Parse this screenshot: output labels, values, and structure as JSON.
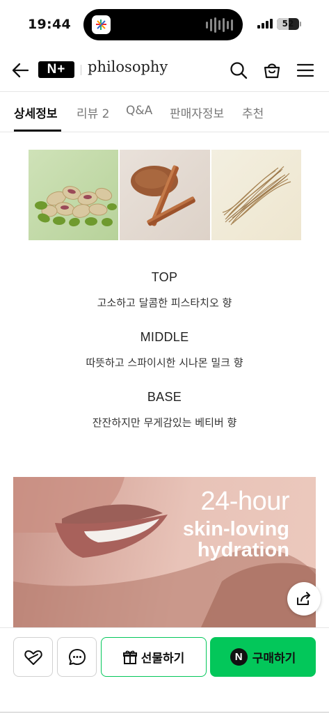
{
  "status_bar": {
    "time": "19:44",
    "battery": "52",
    "battery_level": 0.52
  },
  "header": {
    "logo_text": "N+",
    "brand_name": "philosophy",
    "icons": [
      "back-arrow-icon",
      "search-icon",
      "shopping-bag-icon",
      "hamburger-menu-icon"
    ]
  },
  "tabs": [
    {
      "label": "상세정보",
      "active": true
    },
    {
      "label": "리뷰 2",
      "active": false
    },
    {
      "label": "Q&A",
      "active": false
    },
    {
      "label": "판매자정보",
      "active": false
    },
    {
      "label": "추천",
      "active": false
    }
  ],
  "ingredients": [
    "pistachio",
    "cinnamon",
    "vetiver-root"
  ],
  "notes": [
    {
      "title": "TOP",
      "desc": "고소하고 달콤한 피스타치오 향"
    },
    {
      "title": "MIDDLE",
      "desc": "따뜻하고 스파이시한 시나몬 밀크 향"
    },
    {
      "title": "BASE",
      "desc": "잔잔하지만 무게감있는 베티버 향"
    }
  ],
  "banner": {
    "line1": "24-hour",
    "line2": "skin-loving",
    "line3": "hydration"
  },
  "bottom_bar": {
    "gift_label": "선물하기",
    "buy_label": "구매하기",
    "npay_logo": "N"
  },
  "colors": {
    "accent_green": "#03c75a",
    "text_primary": "#111111"
  }
}
